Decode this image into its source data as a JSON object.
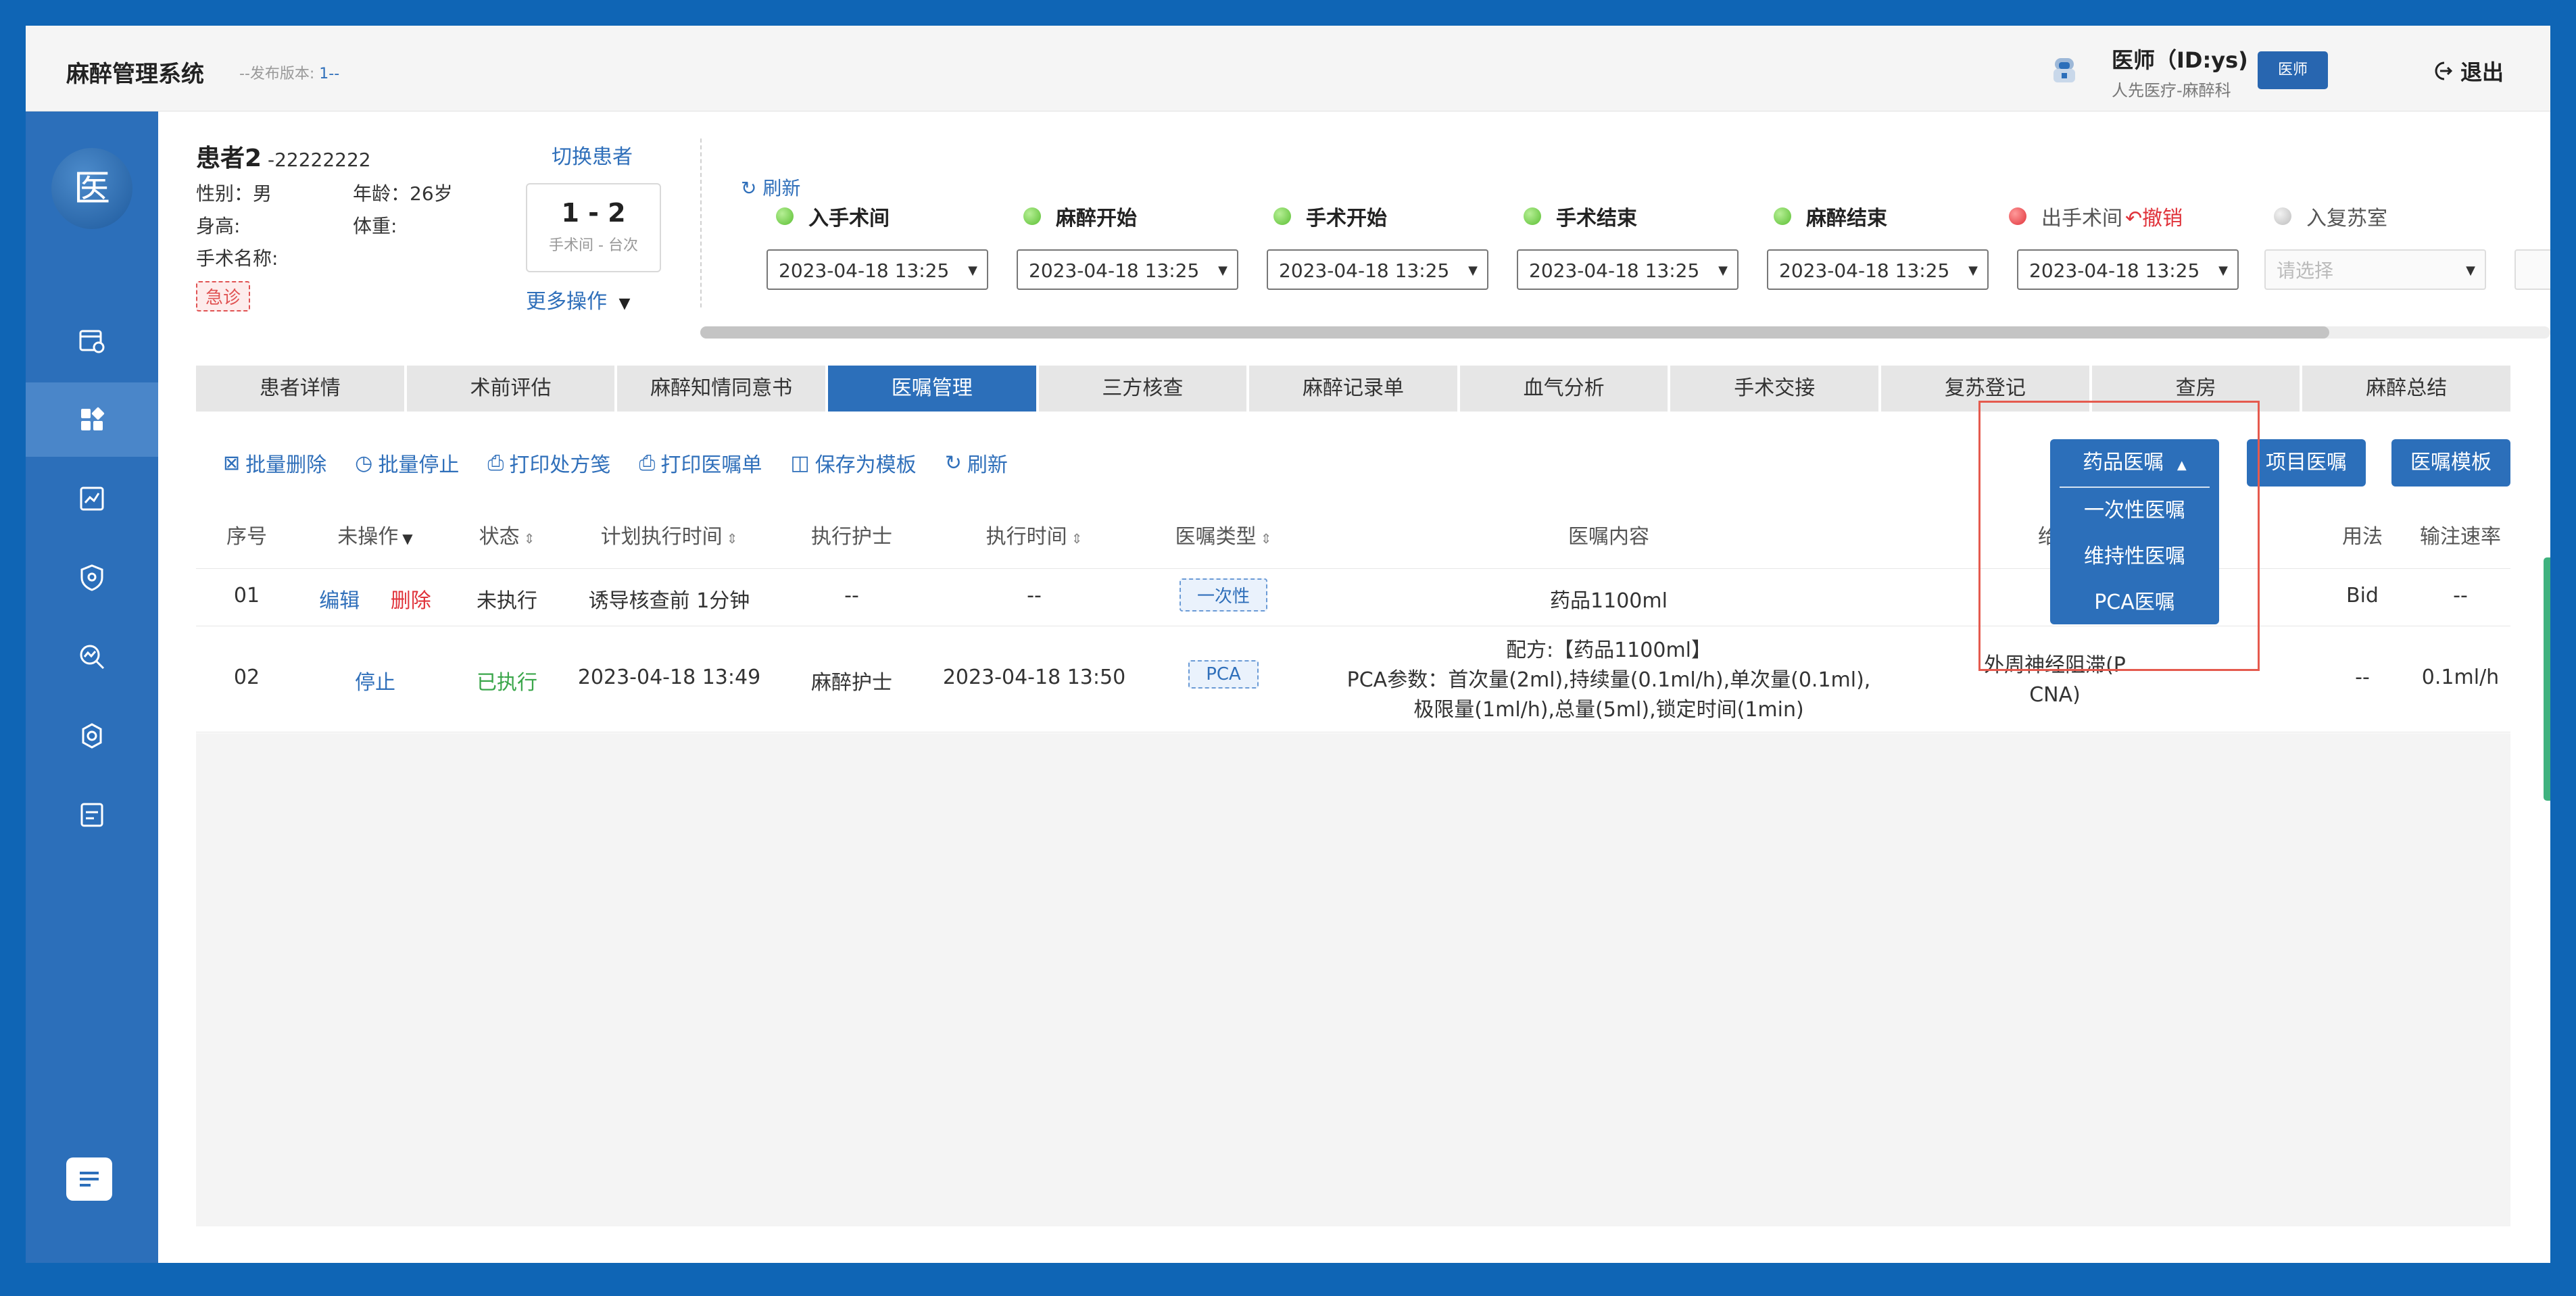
{
  "header": {
    "app_title": "麻醉管理系统",
    "version_label": "--发布版本:",
    "version_value": "1--",
    "user_name": "医师（ID:ys)",
    "user_dept": "人先医疗-麻醉科",
    "role_badge": "医师",
    "logout_label": "退出"
  },
  "sidebar": {
    "logo_text": "医",
    "items": [
      "calendar-card-icon",
      "dashboard-grid-icon",
      "trend-chart-icon",
      "shield-icon",
      "search-chart-icon",
      "gear-icon",
      "form-icon"
    ],
    "active_index": 1
  },
  "patient": {
    "name": "患者2",
    "id": "-22222222",
    "sex": "性别：男",
    "age": "年龄：26岁",
    "height": "身高:",
    "weight": "体重:",
    "surgery_name": "手术名称:",
    "urgent_tag": "急诊",
    "switch_label": "切换患者",
    "room": "1 - 2",
    "room_sub": "手术间 - 台次",
    "more_ops": "更多操作"
  },
  "timeline": {
    "refresh_label": "刷新",
    "stages": [
      {
        "label": "入手术间",
        "status": "green",
        "time": "2023-04-18 13:25"
      },
      {
        "label": "麻醉开始",
        "status": "green",
        "time": "2023-04-18 13:25"
      },
      {
        "label": "手术开始",
        "status": "green",
        "time": "2023-04-18 13:25"
      },
      {
        "label": "手术结束",
        "status": "green",
        "time": "2023-04-18 13:25"
      },
      {
        "label": "麻醉结束",
        "status": "green",
        "time": "2023-04-18 13:25"
      },
      {
        "label": "出手术间",
        "status": "red",
        "time": "2023-04-18 13:25",
        "action": "撤销"
      },
      {
        "label": "入复苏室",
        "status": "gray",
        "placeholder": "请选择"
      }
    ]
  },
  "tabs": [
    "患者详情",
    "术前评估",
    "麻醉知情同意书",
    "医嘱管理",
    "三方核查",
    "麻醉记录单",
    "血气分析",
    "手术交接",
    "复苏登记",
    "查房",
    "麻醉总结"
  ],
  "active_tab": "医嘱管理",
  "toolbar": {
    "batch_delete": "批量删除",
    "batch_stop": "批量停止",
    "print_prescription": "打印处方笺",
    "print_orders": "打印医嘱单",
    "save_template": "保存为模板",
    "refresh": "刷新",
    "drug_orders": "药品医嘱",
    "item_orders": "项目医嘱",
    "order_templates": "医嘱模板"
  },
  "dropdown": {
    "options": [
      "一次性医嘱",
      "维持性医嘱",
      "PCA医嘱"
    ]
  },
  "table": {
    "headers": {
      "seq": "序号",
      "op": "未操作",
      "status": "状态",
      "plan_time": "计划执行时间",
      "nurse": "执行护士",
      "exec_time": "执行时间",
      "type": "医嘱类型",
      "content": "医嘱内容",
      "route_partial": "给",
      "usage": "用法",
      "rate": "输注速率"
    },
    "rows": [
      {
        "seq": "01",
        "actions": [
          "编辑",
          "删除"
        ],
        "status": "未执行",
        "plan_time": "诱导核查前 1分钟",
        "nurse": "--",
        "exec_time": "--",
        "type": "一次性",
        "content": [
          "药品1100ml"
        ],
        "route": "",
        "usage": "Bid",
        "rate": "--"
      },
      {
        "seq": "02",
        "actions": [
          "停止"
        ],
        "status": "已执行",
        "plan_time": "2023-04-18 13:49",
        "nurse": "麻醉护士",
        "exec_time": "2023-04-18 13:50",
        "type": "PCA",
        "content": [
          "配方:【药品1100ml】",
          "PCA参数：首次量(2ml),持续量(0.1ml/h),单次量(0.1ml),",
          "极限量(1ml/h),总量(5ml),锁定时间(1min)"
        ],
        "route": [
          "外周神经阻滞(P",
          "CNA)"
        ],
        "usage": "--",
        "rate": "0.1ml/h"
      }
    ]
  },
  "colors": {
    "primary": "#2c6fba",
    "frame": "#0f65b5",
    "danger": "#e0323a",
    "success": "#3aa64a",
    "highlight_box": "#e55a4e"
  }
}
